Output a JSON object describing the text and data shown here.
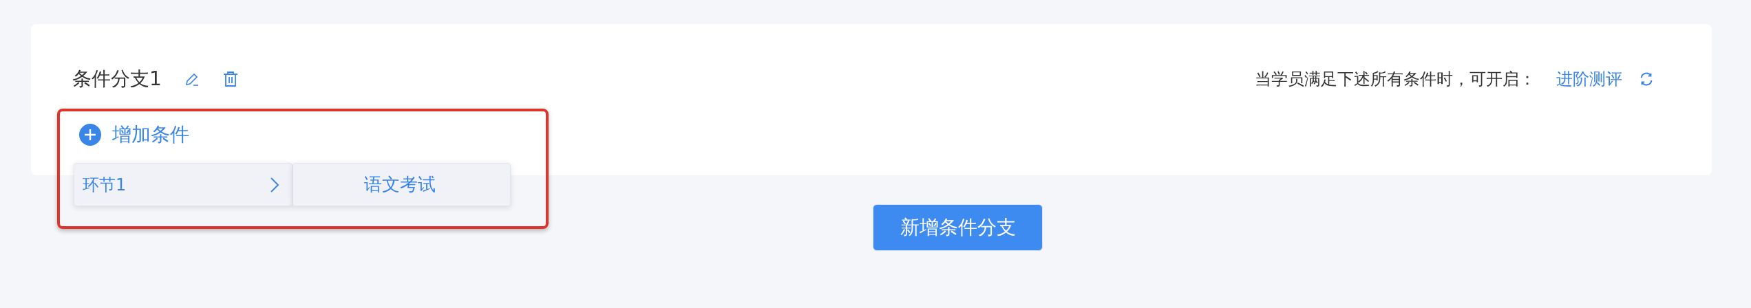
{
  "branch": {
    "title": "条件分支1",
    "rule_text": "当学员满足下述所有条件时，可开启：",
    "target_link": "进阶测评",
    "add_condition": "增加条件"
  },
  "cascader": {
    "panels": [
      {
        "label": "环节1",
        "kind": "parent"
      },
      {
        "label": "语文考试",
        "kind": "leaf"
      }
    ]
  },
  "add_branch_button": "新增条件分支"
}
